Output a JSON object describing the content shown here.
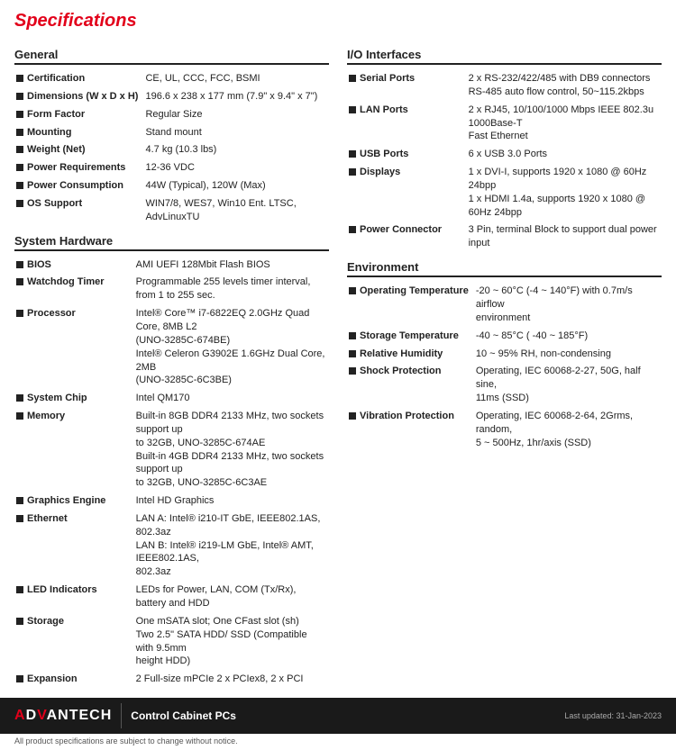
{
  "title": "Specifications",
  "sections": {
    "general": {
      "heading": "General",
      "rows": [
        {
          "label": "Certification",
          "value": "CE, UL, CCC, FCC, BSMI"
        },
        {
          "label": "Dimensions (W x D x H)",
          "value": "196.6 x 238 x 177 mm (7.9\" x 9.4\" x 7\")"
        },
        {
          "label": "Form Factor",
          "value": "Regular Size"
        },
        {
          "label": "Mounting",
          "value": "Stand mount"
        },
        {
          "label": "Weight (Net)",
          "value": "4.7 kg (10.3 lbs)"
        },
        {
          "label": "Power Requirements",
          "value": "12-36 VDC"
        },
        {
          "label": "Power Consumption",
          "value": "44W (Typical), 120W (Max)"
        },
        {
          "label": "OS Support",
          "value": "WIN7/8, WES7, Win10 Ent. LTSC, AdvLinuxTU"
        }
      ]
    },
    "system_hardware": {
      "heading": "System Hardware",
      "rows": [
        {
          "label": "BIOS",
          "value": "AMI UEFI 128Mbit Flash BIOS"
        },
        {
          "label": "Watchdog Timer",
          "value": "Programmable 255 levels timer interval,\nfrom 1 to 255 sec."
        },
        {
          "label": "Processor",
          "value": "Intel® Core™ i7-6822EQ 2.0GHz Quad Core, 8MB L2\n(UNO-3285C-674BE)\nIntel® Celeron G3902E 1.6GHz Dual Core, 2MB\n(UNO-3285C-6C3BE)"
        },
        {
          "label": "System Chip",
          "value": "Intel QM170"
        },
        {
          "label": "Memory",
          "value": "Built-in 8GB DDR4 2133 MHz, two sockets support up\nto 32GB, UNO-3285C-674AE\nBuilt-in 4GB DDR4 2133 MHz, two sockets support up\nto 32GB, UNO-3285C-6C3AE"
        },
        {
          "label": "Graphics Engine",
          "value": "Intel HD Graphics"
        },
        {
          "label": "Ethernet",
          "value": "LAN A: Intel® i210-IT GbE, IEEE802.1AS, 802.3az\nLAN B: Intel® i219-LM GbE, Intel® AMT, IEEE802.1AS,\n802.3az"
        },
        {
          "label": "LED Indicators",
          "value": "LEDs for Power, LAN, COM (Tx/Rx), battery and HDD"
        },
        {
          "label": "Storage",
          "value": "One mSATA slot; One CFast slot (sh)\nTwo 2.5\" SATA HDD/ SSD (Compatible with 9.5mm\nheight HDD)"
        },
        {
          "label": "Expansion",
          "value": "2 Full-size mPCIe 2 x PCIex8, 2 x PCI"
        }
      ]
    },
    "io_interfaces": {
      "heading": "I/O Interfaces",
      "rows": [
        {
          "label": "Serial Ports",
          "value": "2 x RS-232/422/485 with DB9 connectors\nRS-485 auto flow control, 50~115.2kbps"
        },
        {
          "label": "LAN Ports",
          "value": "2 x RJ45, 10/100/1000 Mbps IEEE 802.3u 1000Base-T\nFast Ethernet"
        },
        {
          "label": "USB Ports",
          "value": "6 x USB 3.0 Ports"
        },
        {
          "label": "Displays",
          "value": "1 x DVI-I, supports 1920 x 1080 @ 60Hz 24bpp\n1 x HDMI 1.4a, supports 1920 x 1080 @ 60Hz 24bpp"
        },
        {
          "label": "Power Connector",
          "value": "3 Pin, terminal Block to support dual power input"
        }
      ]
    },
    "environment": {
      "heading": "Environment",
      "rows": [
        {
          "label": "Operating Temperature",
          "value": "-20 ~ 60°C (-4 ~ 140°F) with 0.7m/s airflow\nenvironment"
        },
        {
          "label": "Storage Temperature",
          "value": "-40 ~ 85°C ( -40 ~ 185°F)"
        },
        {
          "label": "Relative Humidity",
          "value": "10 ~ 95% RH, non-condensing"
        },
        {
          "label": "Shock Protection",
          "value": "Operating, IEC 60068-2-27, 50G, half sine,\n11ms (SSD)"
        },
        {
          "label": "Vibration Protection",
          "value": "Operating, IEC 60068-2-64, 2Grms, random,\n5 ~ 500Hz, 1hr/axis (SSD)"
        }
      ]
    }
  },
  "footer": {
    "brand_adv": "AD",
    "brand_vantech": "VANTECH",
    "product_line": "Control Cabinet PCs",
    "notice": "All product specifications are subject to change without notice.",
    "updated": "Last updated: 31-Jan-2023"
  }
}
